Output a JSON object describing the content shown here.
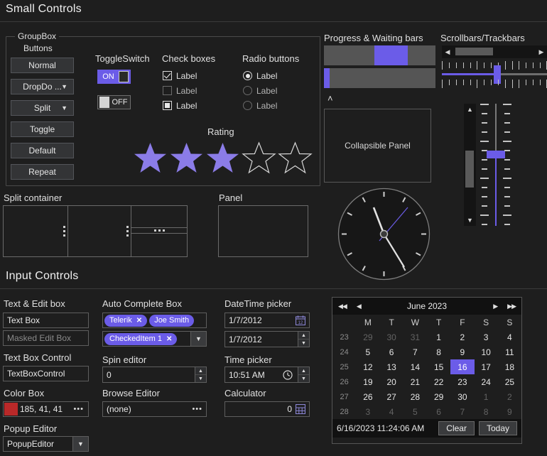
{
  "sections": {
    "small_controls": "Small Controls",
    "input_controls": "Input Controls"
  },
  "groupbox": {
    "title": "GroupBox",
    "buttons_label": "Buttons",
    "buttons": [
      {
        "label": "Normal",
        "caret": ""
      },
      {
        "label": "DropDo ...",
        "caret": "▼"
      },
      {
        "label": "Split",
        "caret": "▼"
      },
      {
        "label": "Toggle",
        "caret": ""
      },
      {
        "label": "Default",
        "caret": ""
      },
      {
        "label": "Repeat",
        "caret": ""
      }
    ]
  },
  "toggleswitch": {
    "title": "ToggleSwitch",
    "on_label": "ON",
    "off_label": "OFF"
  },
  "checkboxes": {
    "title": "Check boxes",
    "items": [
      {
        "label": "Label",
        "state": "checked"
      },
      {
        "label": "Label",
        "state": "empty"
      },
      {
        "label": "Label",
        "state": "indeterminate"
      }
    ]
  },
  "radios": {
    "title": "Radio buttons",
    "items": [
      {
        "label": "Label",
        "state": "selected"
      },
      {
        "label": "Label",
        "state": "empty"
      },
      {
        "label": "Label",
        "state": "empty"
      }
    ]
  },
  "rating": {
    "title": "Rating",
    "value": 3,
    "max": 5
  },
  "progress": {
    "title": "Progress & Waiting bars",
    "progress_value": 50,
    "waiting_value": 5
  },
  "collapsible": {
    "label": "Collapsible Panel",
    "expander_icon": "˄"
  },
  "scrollbars": {
    "title": "Scrollbars/Trackbars",
    "h_left_arrow": "◀",
    "h_right_arrow": "▶",
    "v_up_arrow": "▲",
    "v_down_arrow": "▼"
  },
  "splitcontainer": {
    "title": "Split container"
  },
  "panel": {
    "title": "Panel"
  },
  "clock": {
    "time": "11:24:06 AM"
  },
  "text_edit": {
    "title": "Text & Edit box",
    "textbox_value": "Text Box",
    "masked_placeholder": "Masked Edit Box",
    "control_title": "Text Box Control",
    "control_value": "TextBoxControl"
  },
  "colorbox": {
    "title": "Color Box",
    "value": "185, 41, 41",
    "swatch": "#b92929",
    "ellipsis": "•••"
  },
  "popup_editor": {
    "title": "Popup Editor",
    "value": "PopupEditor",
    "caret": "▼"
  },
  "autocomplete": {
    "title": "Auto Complete Box",
    "tokens_row1": [
      {
        "label": "Telerik",
        "closable": true
      },
      {
        "label": "Joe Smith",
        "closable": false
      }
    ],
    "tokens_row2": [
      {
        "label": "CheckedItem 1",
        "closable": true
      }
    ],
    "caret": "▼",
    "close_glyph": "✕"
  },
  "spin_editor": {
    "title": "Spin editor",
    "value": "0",
    "up": "▲",
    "down": "▼"
  },
  "browse_editor": {
    "title": "Browse Editor",
    "value": "(none)",
    "ellipsis": "•••"
  },
  "datetime": {
    "title": "DateTime picker",
    "value1": "1/7/2012",
    "value2": "1/7/2012",
    "calendar_icon": "calendar-icon",
    "up": "▲",
    "down": "▼"
  },
  "timepicker": {
    "title": "Time picker",
    "value": "10:51 AM",
    "clock_icon": "clock-icon",
    "up": "▲",
    "down": "▼"
  },
  "calculator": {
    "title": "Calculator",
    "value": "0",
    "icon": "calculator-icon"
  },
  "calendar": {
    "header": "June 2023",
    "nav": {
      "first": "◀◀",
      "prev": "◀",
      "next": "▶",
      "last": "▶▶"
    },
    "weekday_corner": "",
    "weekdays": [
      "M",
      "T",
      "W",
      "T",
      "F",
      "S",
      "S"
    ],
    "rows": [
      {
        "week": "23",
        "days": [
          {
            "d": "29",
            "other": true
          },
          {
            "d": "30",
            "other": true
          },
          {
            "d": "31",
            "other": true
          },
          {
            "d": "1"
          },
          {
            "d": "2"
          },
          {
            "d": "3"
          },
          {
            "d": "4"
          }
        ]
      },
      {
        "week": "24",
        "days": [
          {
            "d": "5"
          },
          {
            "d": "6"
          },
          {
            "d": "7"
          },
          {
            "d": "8"
          },
          {
            "d": "9"
          },
          {
            "d": "10"
          },
          {
            "d": "11"
          }
        ]
      },
      {
        "week": "25",
        "days": [
          {
            "d": "12"
          },
          {
            "d": "13"
          },
          {
            "d": "14"
          },
          {
            "d": "15"
          },
          {
            "d": "16",
            "selected": true
          },
          {
            "d": "17"
          },
          {
            "d": "18"
          }
        ]
      },
      {
        "week": "26",
        "days": [
          {
            "d": "19"
          },
          {
            "d": "20"
          },
          {
            "d": "21"
          },
          {
            "d": "22"
          },
          {
            "d": "23"
          },
          {
            "d": "24"
          },
          {
            "d": "25"
          }
        ]
      },
      {
        "week": "27",
        "days": [
          {
            "d": "26"
          },
          {
            "d": "27"
          },
          {
            "d": "28"
          },
          {
            "d": "29"
          },
          {
            "d": "30"
          },
          {
            "d": "1",
            "other": true
          },
          {
            "d": "2",
            "other": true
          }
        ]
      },
      {
        "week": "28",
        "days": [
          {
            "d": "3",
            "other": true
          },
          {
            "d": "4",
            "other": true
          },
          {
            "d": "5",
            "other": true
          },
          {
            "d": "6",
            "other": true
          },
          {
            "d": "7",
            "other": true
          },
          {
            "d": "8",
            "other": true
          },
          {
            "d": "9",
            "other": true
          }
        ]
      }
    ],
    "footer_stamp": "6/16/2023 11:24:06 AM",
    "clear_label": "Clear",
    "today_label": "Today"
  },
  "colors": {
    "accent": "#6b5ce8",
    "background": "#1e1e1e",
    "panel": "#2b2b2b",
    "border": "#5e5e5e",
    "text": "#e8e8e8"
  }
}
